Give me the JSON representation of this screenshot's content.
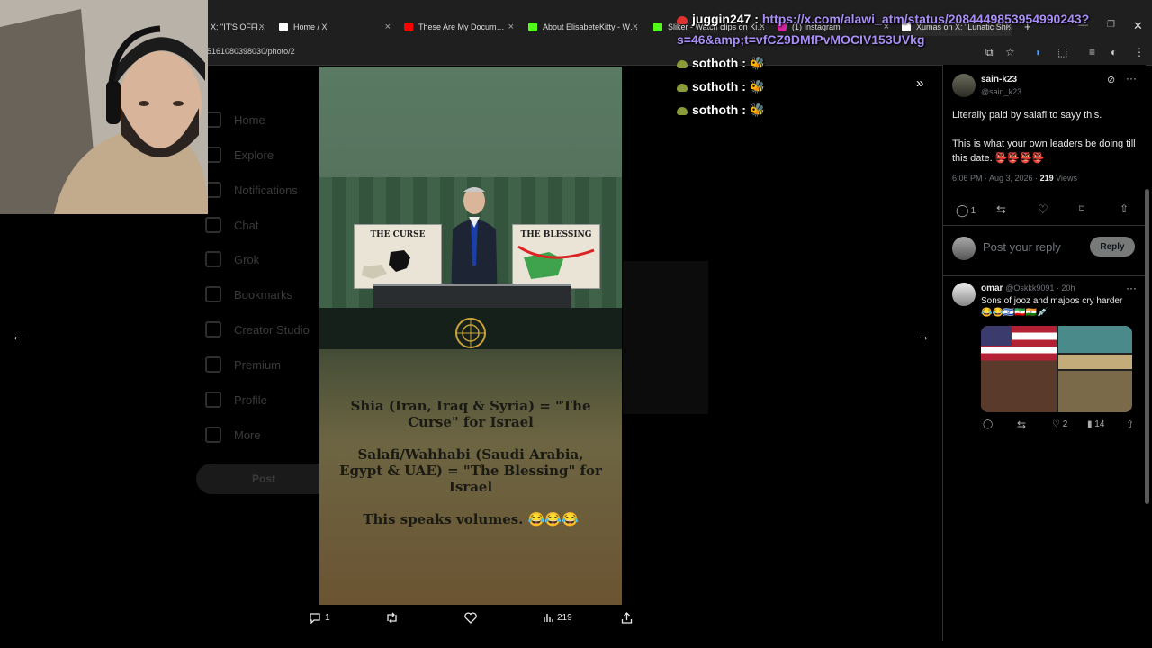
{
  "tabs": [
    {
      "label": "X: \"IT'S OFFI…",
      "color": "#fff"
    },
    {
      "label": "Home / X",
      "color": "#fff"
    },
    {
      "label": "These Are My Docum…",
      "color": "#f00"
    },
    {
      "label": "About ElisabeteKitty - W…",
      "color": "#53fc18"
    },
    {
      "label": "Sliker - Watch clips on Ki…",
      "color": "#53fc18"
    },
    {
      "label": "(1) Instagram",
      "color": "#d6249f"
    },
    {
      "label": "Xumas on X: \"Lunatic Shi…",
      "color": "#fff"
    }
  ],
  "url": "5161080398030/photo/2",
  "sidebar": {
    "items": [
      "Home",
      "Explore",
      "Notifications",
      "Chat",
      "Grok",
      "Bookmarks",
      "Creator Studio",
      "Premium",
      "Profile",
      "More"
    ],
    "post_label": "Post"
  },
  "image": {
    "sign_left": "THE CURSE",
    "sign_right": "THE BLESSING",
    "text_p1": "Shia (Iran, Iraq & Syria) = \"The Curse\" for Israel",
    "text_p2": "Salafi/Wahhabi (Saudi Arabia, Egypt & UAE) = \"The Blessing\" for Israel",
    "text_p3": "This speaks volumes. 😂😂😂"
  },
  "actions": {
    "replies": "1",
    "views": "219"
  },
  "reply_tweet": {
    "name": "sain-k23",
    "handle": "@sain_k23",
    "line1": "Literally paid by salafi to sayy this.",
    "line2": "This is what your own leaders be doing till this date. 👺👺👺👺",
    "time": "6:06 PM · Aug 3, 2026 · ",
    "views_num": "219",
    "views_label": " Views",
    "reply_count": "1"
  },
  "reply_box": {
    "placeholder": "Post your reply",
    "button": "Reply"
  },
  "comment": {
    "name": "omar",
    "handle": "@Oskkk9091 · 20h",
    "text": "Sons of jooz and majoos cry harder",
    "emojis": "😂😂🇮🇱🇮🇷🇮🇳💉",
    "likes": "2",
    "views": "14"
  },
  "chat": [
    {
      "user": "juggin247",
      "text": "https://x.com/alawi_atm/status/2084449853954990243?",
      "text2": "s=46&amp;t=vfCZ9DMfPvMOCIV153UVkg",
      "color": "#ffffff"
    },
    {
      "user": "sothoth",
      "text": "🐝",
      "color": "#ffffff"
    },
    {
      "user": "sothoth",
      "text": "🐝",
      "color": "#ffffff"
    },
    {
      "user": "sothoth",
      "text": "🐝",
      "color": "#ffffff"
    }
  ]
}
